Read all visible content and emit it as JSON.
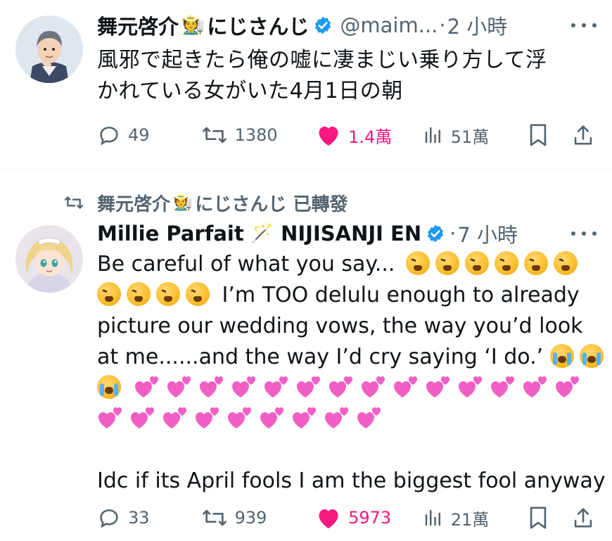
{
  "tweet1": {
    "display_name": "舞元啓介",
    "name_emoji": "🧑‍🌾",
    "name_suffix": "にじさんじ",
    "handle": "@maim...",
    "separator": "·",
    "time": "2 小時",
    "text_line1": "風邪で起きたら俺の嘘に凄まじい乗り方して浮",
    "text_line2": "かれている女がいた4月1日の朝",
    "actions": {
      "replies": "49",
      "retweets": "1380",
      "likes": "1.4萬",
      "views": "51萬"
    }
  },
  "retweet_banner": {
    "name": "舞元啓介",
    "emoji": "🧑‍🌾",
    "suffix": "にじさんじ 已轉發"
  },
  "tweet2": {
    "display_name": "Millie Parfait",
    "name_emoji": "🪄",
    "name_suffix": "NIJISANJI EN",
    "separator": "·",
    "time": "7 小時",
    "line1": "Be careful of what you say...",
    "line2_text": "I’m TOO delulu enough to already",
    "line3": "picture our wedding vows, the way you’d look",
    "line4": "at me......and the way I’d cry saying ‘I do.’",
    "line6": "Idc if its April fools I am the biggest fool anyway",
    "emoji_names": [
      "tired-face",
      "loudly-crying-face",
      "two-hearts"
    ],
    "actions": {
      "replies": "33",
      "retweets": "939",
      "likes": "5973",
      "views": "21萬"
    }
  },
  "colors": {
    "text": "#0f1419",
    "secondary": "#536471",
    "like": "#f91880",
    "verified": "#1d9bf0"
  }
}
